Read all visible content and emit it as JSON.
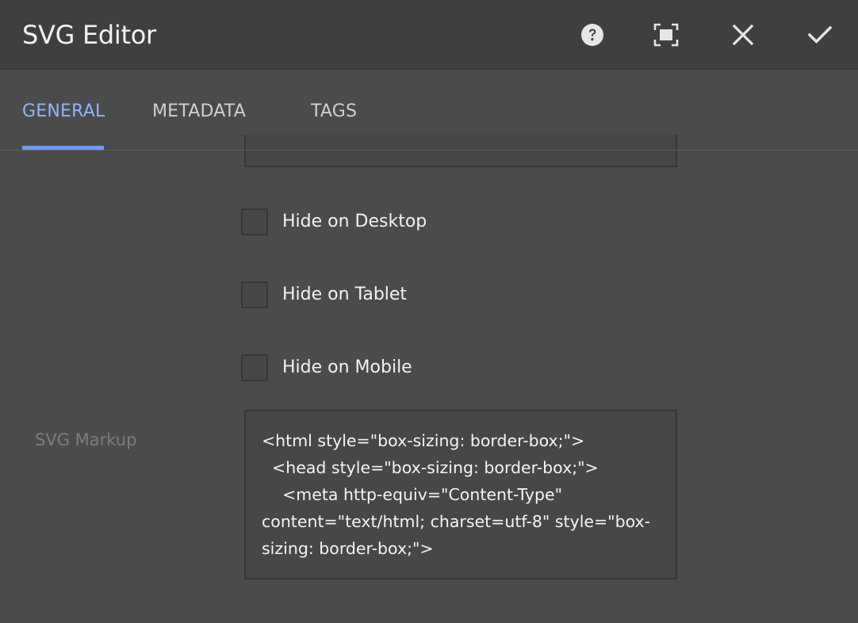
{
  "dialog": {
    "title": "SVG Editor",
    "toolbar": {
      "help_icon": "help-icon",
      "fullscreen_icon": "fullscreen-icon",
      "close_icon": "close-icon",
      "done_icon": "checkmark-icon"
    }
  },
  "tabs": [
    {
      "label": "GENERAL",
      "active": true
    },
    {
      "label": "METADATA",
      "active": false
    },
    {
      "label": "TAGS",
      "active": false
    }
  ],
  "form": {
    "checkboxes": [
      {
        "label": "Hide on Desktop",
        "checked": false
      },
      {
        "label": "Hide on Tablet",
        "checked": false
      },
      {
        "label": "Hide on Mobile",
        "checked": false
      }
    ],
    "svg_markup": {
      "label": "SVG Markup",
      "value": "<html style=\"box-sizing: border-box;\">\n  <head style=\"box-sizing: border-box;\">\n    <meta http-equiv=\"Content-Type\" content=\"text/html; charset=utf-8\" style=\"box-sizing: border-box;\">"
    }
  },
  "colors": {
    "background": "#4b4b4b",
    "titlebar": "#3f3f3f",
    "accent": "#6e9cf5",
    "active_tab_text": "#8fb4ff",
    "muted_label": "#7c7c7c"
  }
}
